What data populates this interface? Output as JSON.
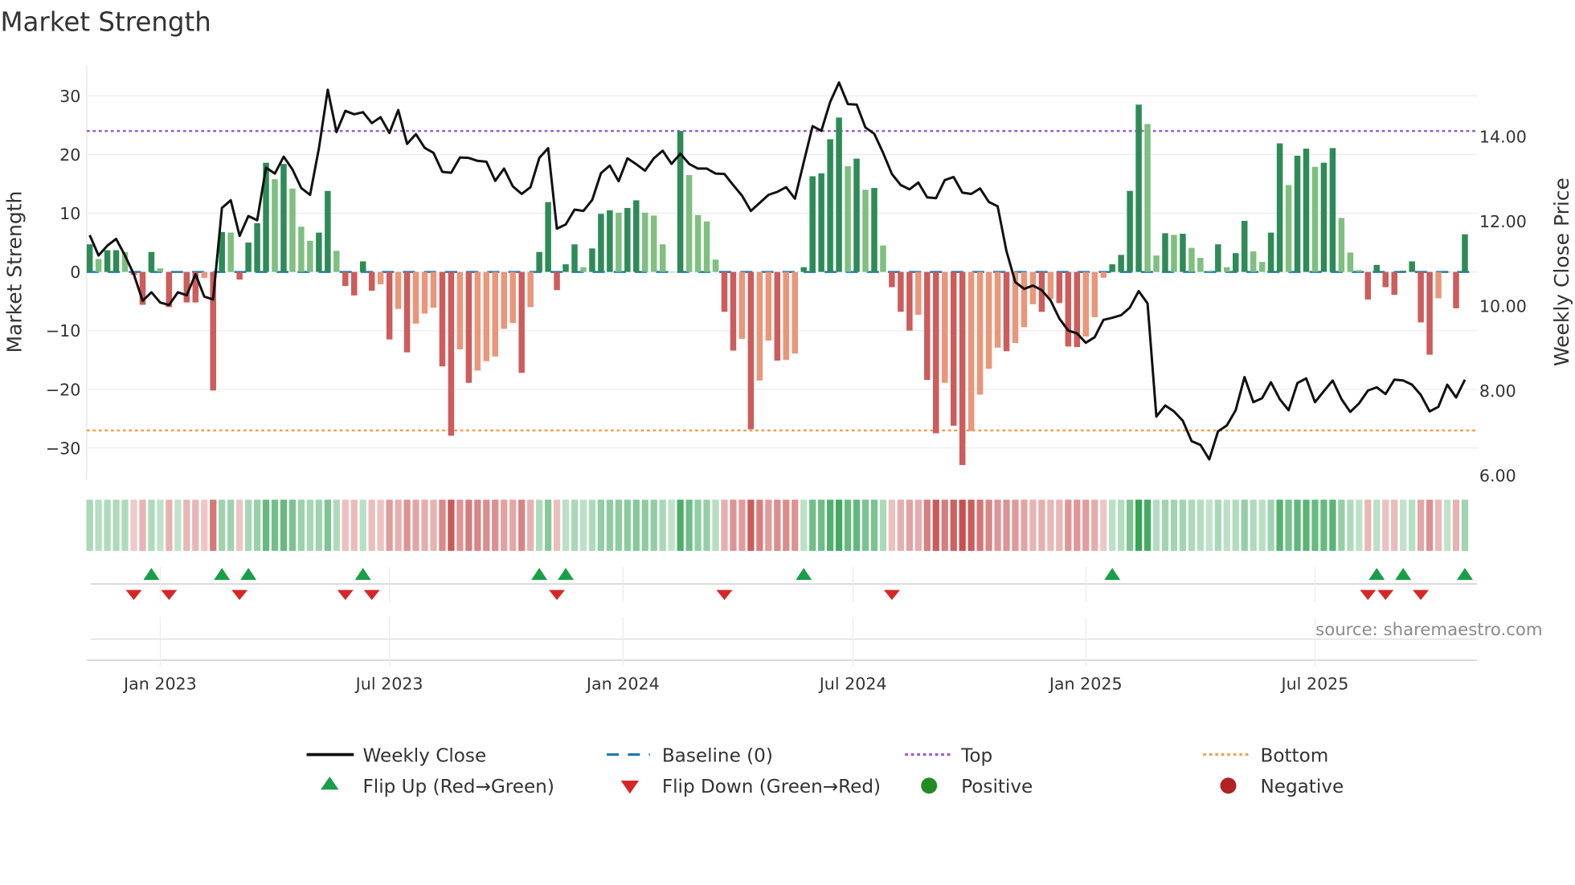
{
  "chart_data": {
    "type": "bar",
    "title": "Market Strength",
    "ylabel": "Market Strength",
    "y2label": "Weekly Close Price",
    "ylim": [
      -35,
      35
    ],
    "y2lim": [
      5.6,
      15.6
    ],
    "y_ticks": [
      30,
      20,
      10,
      0,
      -10,
      -20,
      -30
    ],
    "y_tick_labels": [
      "30",
      "20",
      "10",
      "0",
      "−10",
      "−20",
      "−30"
    ],
    "y2_ticks": [
      14,
      12,
      10,
      8,
      6
    ],
    "y2_tick_labels": [
      "14.00",
      "12.00",
      "10.00",
      "8.00",
      "6.00"
    ],
    "x_ticks": [
      {
        "label": "Jan 2023",
        "index": 8
      },
      {
        "label": "Jul 2023",
        "index": 34
      },
      {
        "label": "Jan 2024",
        "index": 60.5
      },
      {
        "label": "Jul 2024",
        "index": 86.6
      },
      {
        "label": "Jan 2025",
        "index": 113
      },
      {
        "label": "Jul 2025",
        "index": 139
      }
    ],
    "top_level": 24,
    "bottom_level": -27,
    "baseline": 0,
    "strength": [
      4.7,
      2.2,
      3.7,
      3.7,
      3.4,
      -0.5,
      -5.6,
      3.4,
      0.6,
      -6,
      0,
      -5.2,
      -5.2,
      -1,
      -20.2,
      6.8,
      6.7,
      -1.3,
      5,
      8.3,
      18.6,
      15.8,
      18.4,
      14.2,
      7.7,
      5.3,
      6.7,
      13.8,
      3.6,
      -2.4,
      -4,
      1.8,
      -3.2,
      -2.1,
      -11.5,
      -6.3,
      -13.7,
      -8.8,
      -7.1,
      -6.1,
      -16.1,
      -27.9,
      -13.2,
      -18.9,
      -16.8,
      -15.2,
      -14.4,
      -9.7,
      -8.7,
      -17.2,
      -6,
      3.4,
      11.9,
      -3.1,
      1.3,
      4.7,
      0.8,
      4,
      9.9,
      10.5,
      10.1,
      10.9,
      12.2,
      10.1,
      9.6,
      4.7,
      0,
      24,
      16.5,
      9.7,
      8.6,
      2.1,
      -6.8,
      -13.4,
      -11.4,
      -26.8,
      -18.5,
      -11.7,
      -15.1,
      -15,
      -13.9,
      0.8,
      16.3,
      16.8,
      22.6,
      26.3,
      18,
      19.3,
      14,
      14.3,
      4.5,
      -2.6,
      -6.8,
      -10,
      -7.3,
      -18.4,
      -27.5,
      -18.9,
      -26.2,
      -32.9,
      -27.1,
      -20.9,
      -16.5,
      -12.9,
      -13.5,
      -12.1,
      -9.4,
      -5.5,
      -6.8,
      -4.6,
      -5.3,
      -12.7,
      -12.8,
      -11,
      -7.7,
      -1,
      1.3,
      2.9,
      13.8,
      28.5,
      25.2,
      2.8,
      6.6,
      6.3,
      6.5,
      4.1,
      2.4,
      0.2,
      4.7,
      0.8,
      3.2,
      8.7,
      3.5,
      1.7,
      6.7,
      21.9,
      14.8,
      19.8,
      21,
      17.9,
      18.6,
      21.1,
      9.2,
      3.3,
      0.3,
      -4.7,
      1.2,
      -2.6,
      -3.9,
      0.2,
      1.8,
      -8.6,
      -14.1,
      -4.5,
      0,
      -6.2,
      6.4
    ],
    "weekly_close": [
      11.65,
      11.17,
      11.4,
      11.56,
      11.17,
      10.73,
      10.1,
      10.3,
      10.06,
      10.0,
      10.3,
      10.23,
      10.73,
      10.2,
      10.13,
      12.29,
      12.47,
      11.63,
      12.1,
      12.0,
      13.24,
      13.1,
      13.5,
      13.2,
      12.76,
      12.6,
      13.7,
      15.08,
      14.08,
      14.58,
      14.5,
      14.55,
      14.29,
      14.43,
      14.06,
      14.6,
      13.8,
      14.03,
      13.71,
      13.59,
      13.14,
      13.12,
      13.48,
      13.47,
      13.4,
      13.38,
      12.93,
      13.22,
      12.8,
      12.62,
      12.78,
      13.47,
      13.7,
      11.8,
      11.9,
      12.25,
      12.22,
      12.48,
      13.11,
      13.29,
      12.92,
      13.46,
      13.32,
      13.17,
      13.46,
      13.64,
      13.33,
      13.57,
      13.33,
      13.22,
      13.22,
      13.1,
      13.09,
      12.83,
      12.58,
      12.22,
      12.41,
      12.6,
      12.67,
      12.78,
      12.51,
      13.37,
      14.22,
      14.11,
      14.79,
      15.25,
      14.74,
      14.73,
      14.19,
      14.04,
      13.59,
      13.09,
      12.83,
      12.73,
      12.89,
      12.54,
      12.52,
      12.95,
      13.02,
      12.65,
      12.62,
      12.75,
      12.43,
      12.33,
      11.27,
      10.54,
      10.38,
      10.46,
      10.35,
      10.11,
      9.68,
      9.4,
      9.33,
      9.11,
      9.24,
      9.65,
      9.7,
      9.76,
      9.94,
      10.33,
      10.04,
      7.37,
      7.63,
      7.49,
      7.27,
      6.79,
      6.7,
      6.36,
      7.02,
      7.16,
      7.52,
      8.3,
      7.71,
      7.8,
      8.18,
      7.78,
      7.52,
      8.16,
      8.27,
      7.71,
      7.97,
      8.22,
      7.78,
      7.48,
      7.68,
      7.98,
      8.06,
      7.9,
      8.24,
      8.22,
      8.12,
      7.88,
      7.49,
      7.6,
      8.12,
      7.82,
      8.24
    ],
    "legend": {
      "weekly_close": "Weekly Close",
      "baseline": "Baseline (0)",
      "top": "Top",
      "bottom": "Bottom",
      "flip_up": "Flip Up (Red→Green)",
      "flip_down": "Flip Down (Green→Red)",
      "positive": "Positive",
      "negative": "Negative"
    },
    "legend_placement": "bottom",
    "grid": true,
    "annotation": "source: sharemaestro.com",
    "colors": {
      "pos_strong": "#2e8b57",
      "pos_weak": "#7fbf7f",
      "neg_strong": "#cd5c5c",
      "neg_weak": "#e9967a",
      "close": "#111111",
      "baseline": "#1f77b4",
      "top": "#9b59d0",
      "bottom": "#f0a050",
      "flip_up": "#1a9e4a",
      "flip_down": "#d62728",
      "positive": "#228b22",
      "negative": "#b22222"
    }
  }
}
